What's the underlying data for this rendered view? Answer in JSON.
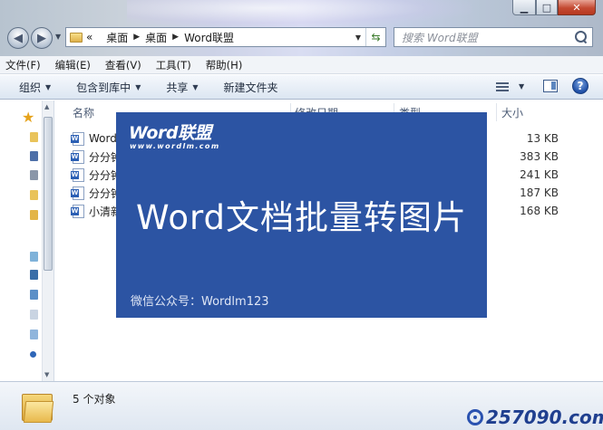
{
  "breadcrumb": {
    "overflow": "«",
    "items": [
      "桌面",
      "桌面",
      "Word联盟"
    ]
  },
  "search": {
    "placeholder": "搜索 Word联盟"
  },
  "menu": [
    "文件(F)",
    "编辑(E)",
    "查看(V)",
    "工具(T)",
    "帮助(H)"
  ],
  "toolbar": {
    "organize": "组织",
    "include_library": "包含到库中",
    "share": "共享",
    "new_folder": "新建文件夹"
  },
  "columns": {
    "name": "名称",
    "modified": "修改日期",
    "type": "类型",
    "size": "大小"
  },
  "files": [
    {
      "name": "Word",
      "size": "13 KB"
    },
    {
      "name": "分分钟",
      "size": "383 KB"
    },
    {
      "name": "分分钟",
      "size": "241 KB"
    },
    {
      "name": "分分钟",
      "size": "187 KB"
    },
    {
      "name": "小清新",
      "size": "168 KB"
    }
  ],
  "banner": {
    "brand": "Word联盟",
    "url": "www.wordlm.com",
    "title": "Word文档批量转图片",
    "wechat": "微信公众号：Wordlm123",
    "background": "#2c54a3"
  },
  "status": {
    "count": "5 个对象"
  },
  "watermark": "257090.com"
}
